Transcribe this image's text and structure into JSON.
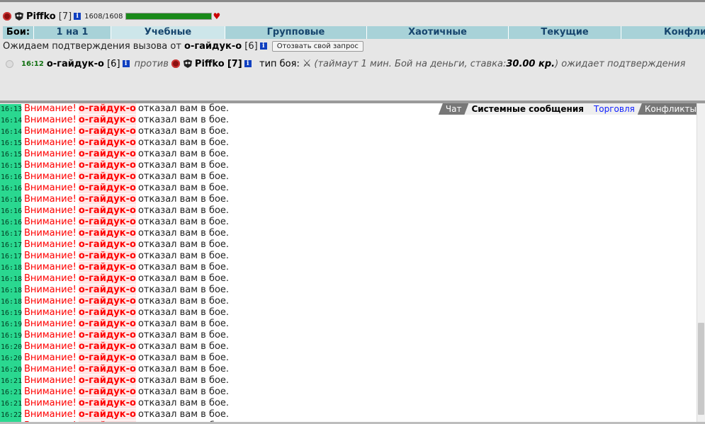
{
  "player": {
    "nick": "Piffko",
    "level": "[7]",
    "hp": "1608/1608",
    "hp_fraction": 1.0,
    "info_icon": "i"
  },
  "fight_tabs": {
    "label": "Бои:",
    "items": [
      "1 на 1",
      "Учебные",
      "Групповые",
      "Хаотичные",
      "Текущие",
      "Конфликты"
    ],
    "active": "Учебные"
  },
  "waiting": {
    "text": "Ожидаем подтверждения вызова от",
    "opponent": "о-гайдук-о",
    "level": "[6]",
    "cancel_button": "Отозвать свой запрос"
  },
  "request": {
    "time": "16:12",
    "opponent": "о-гайдук-о",
    "opponent_level": "[6]",
    "vs": "против",
    "player": "Piffko",
    "player_level": "[7]",
    "type_label": "тип боя:",
    "details_prefix": "(таймаут 1 мин. Бой на деньги, ставка: ",
    "stake": "30.00 кр.",
    "details_suffix": ") ожидает подтверждения"
  },
  "chat_tabs": [
    "Чат",
    "Системные сообщения",
    "Торговля",
    "Конфликты"
  ],
  "log": {
    "prefix": "Внимание!",
    "who": "о-гайдук-о",
    "message": "отказал вам в бое.",
    "timestamps": [
      "16:13",
      "16:14",
      "16:14",
      "16:15",
      "16:15",
      "16:15",
      "16:16",
      "16:16",
      "16:16",
      "16:16",
      "16:16",
      "16:17",
      "16:17",
      "16:17",
      "16:18",
      "16:18",
      "16:18",
      "16:18",
      "16:19",
      "16:19",
      "16:19",
      "16:20",
      "16:20",
      "16:20",
      "16:21",
      "16:21",
      "16:21",
      "16:22",
      "16:22",
      "16:22"
    ]
  },
  "colors": {
    "tab_bg": "#a8d2d8",
    "timestamp_bg": "#2ad890",
    "warning": "#ff0000",
    "hp_bar": "#1a8a1a"
  }
}
